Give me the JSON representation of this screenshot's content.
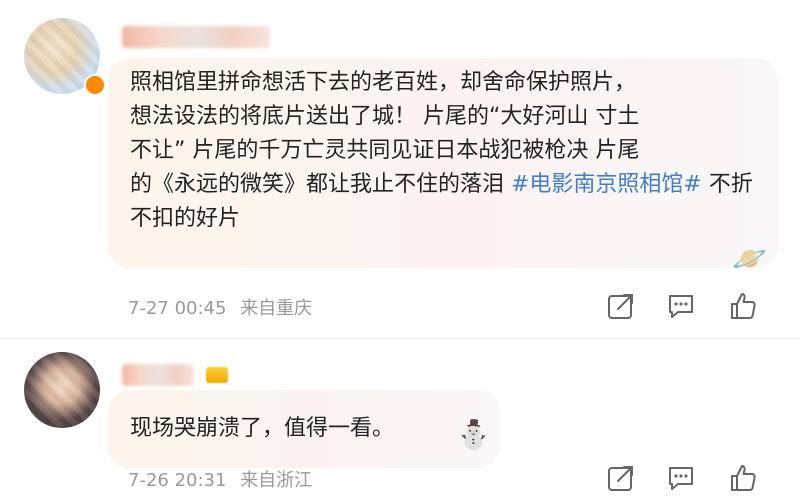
{
  "comments": [
    {
      "text_lines": [
        "照相馆里拼命想活下去的老百姓，却舍命保护照片，",
        "想法设法的将底片送出了城！ 片尾的“大好河山 寸土",
        "不让” 片尾的千万亡灵共同见证日本战犯被枪决 片尾",
        "的《永远的微笑》都让我止不住的落泪 "
      ],
      "hashtag": "#电影南京照相馆#",
      "tail": " 不折不扣的好片",
      "date": "7-27 00:45",
      "location": "来自重庆"
    },
    {
      "text_lines": [
        "现场哭崩溃了，值得一看。"
      ],
      "date": "7-26 20:31",
      "location": "来自浙江"
    }
  ],
  "icons": {
    "share": "share-icon",
    "reply": "comment-icon",
    "like": "thumbs-up-icon"
  },
  "colors": {
    "hashtag": "#3f7ec9",
    "meta_text": "#999999",
    "bubble": "#fcf3ee"
  }
}
